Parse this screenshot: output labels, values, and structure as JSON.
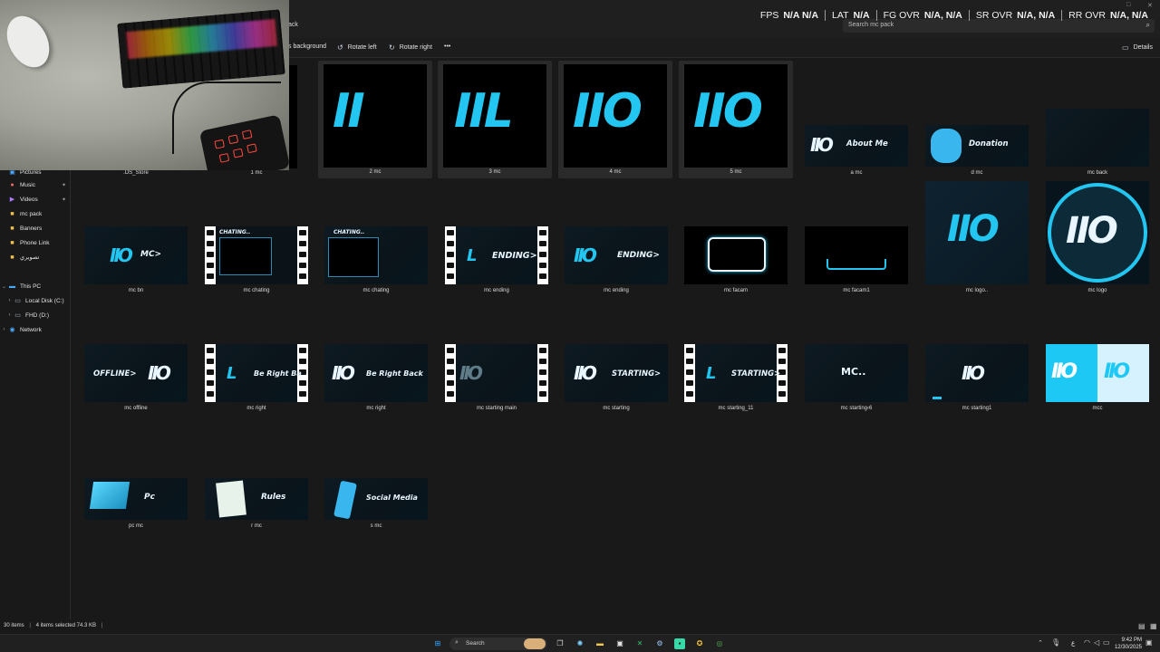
{
  "address": {
    "path": "ack",
    "search_placeholder": "Search mc pack"
  },
  "overlay": [
    {
      "label": "FPS",
      "value": "N/A  N/A"
    },
    {
      "label": "LAT",
      "value": "N/A"
    },
    {
      "label": "FG OVR",
      "value": "N/A, N/A"
    },
    {
      "label": "SR OVR",
      "value": "N/A, N/A"
    },
    {
      "label": "RR OVR",
      "value": "N/A, N/A"
    }
  ],
  "toolbar": {
    "set_background": "s background",
    "rotate_left": "Rotate left",
    "rotate_right": "Rotate right",
    "more": "•••",
    "details": "Details"
  },
  "sidebar": {
    "items": [
      {
        "label": "Pictures",
        "icon": "pictures-icon"
      },
      {
        "label": "Music",
        "icon": "music-icon"
      },
      {
        "label": "Videos",
        "icon": "videos-icon"
      },
      {
        "label": "mc pack",
        "icon": "folder-icon"
      },
      {
        "label": "Banners",
        "icon": "folder-icon"
      },
      {
        "label": "Phone Link",
        "icon": "folder-icon"
      },
      {
        "label": "تصويري",
        "icon": "folder-icon"
      },
      {
        "label": "This PC",
        "icon": "pc-icon"
      },
      {
        "label": "Local Disk (C:)",
        "icon": "drive-icon"
      },
      {
        "label": "FHD (D:)",
        "icon": "drive-icon"
      },
      {
        "label": "Network",
        "icon": "network-icon"
      }
    ]
  },
  "files": [
    {
      "name": ".DS_Store"
    },
    {
      "name": "1 mc"
    },
    {
      "name": "2 mc",
      "logo": "II"
    },
    {
      "name": "3 mc",
      "logo": "IIL"
    },
    {
      "name": "4 mc",
      "logo": "IIO"
    },
    {
      "name": "5 mc",
      "logo": "IIO"
    },
    {
      "name": "a mc",
      "text": "About Me",
      "logo": "IIO"
    },
    {
      "name": "d mc",
      "text": "Donation"
    },
    {
      "name": "mc back"
    },
    {
      "name": "mc bn",
      "logo": "IIO",
      "text": "MC>"
    },
    {
      "name": "mc chating",
      "text": "CHATING.."
    },
    {
      "name": "mc chating",
      "text": "CHATING.."
    },
    {
      "name": "mc ending",
      "text": "ENDING>",
      "logo": "L"
    },
    {
      "name": "mc ending",
      "text": "ENDING>",
      "logo": "IIO"
    },
    {
      "name": "mc facam"
    },
    {
      "name": "mc facam1"
    },
    {
      "name": "mc logo..",
      "logo": "IIO"
    },
    {
      "name": "mc logo",
      "logo": "IIO"
    },
    {
      "name": "mc offline",
      "text": "OFFLINE>",
      "logo": "IIO"
    },
    {
      "name": "mc right",
      "text": "Be Right Ba",
      "logo": "L"
    },
    {
      "name": "mc right",
      "text": "Be Right Back",
      "logo": "IIO"
    },
    {
      "name": "mc starting main",
      "logo": "IIO"
    },
    {
      "name": "mc starting",
      "text": "STARTING>",
      "logo": "IIO"
    },
    {
      "name": "mc starting_11",
      "text": "STARTING>",
      "logo": "L"
    },
    {
      "name": "mc starting‹6",
      "text": "MC.."
    },
    {
      "name": "mc starting1",
      "logo": "IIO"
    },
    {
      "name": "mcc",
      "logo": "IIO"
    },
    {
      "name": "pc mc",
      "text": "Pc"
    },
    {
      "name": "r mc",
      "text": "Rules"
    },
    {
      "name": "s mc",
      "text": "Social Media"
    }
  ],
  "status": {
    "count": "30 items",
    "selected": "4 items selected  74.3 KB"
  },
  "taskbar": {
    "search_label": "Search",
    "time": "9:42 PM",
    "date": "12/30/2025",
    "lang": "ع"
  },
  "colors": {
    "accent": "#22c6f0",
    "background": "#191919"
  }
}
